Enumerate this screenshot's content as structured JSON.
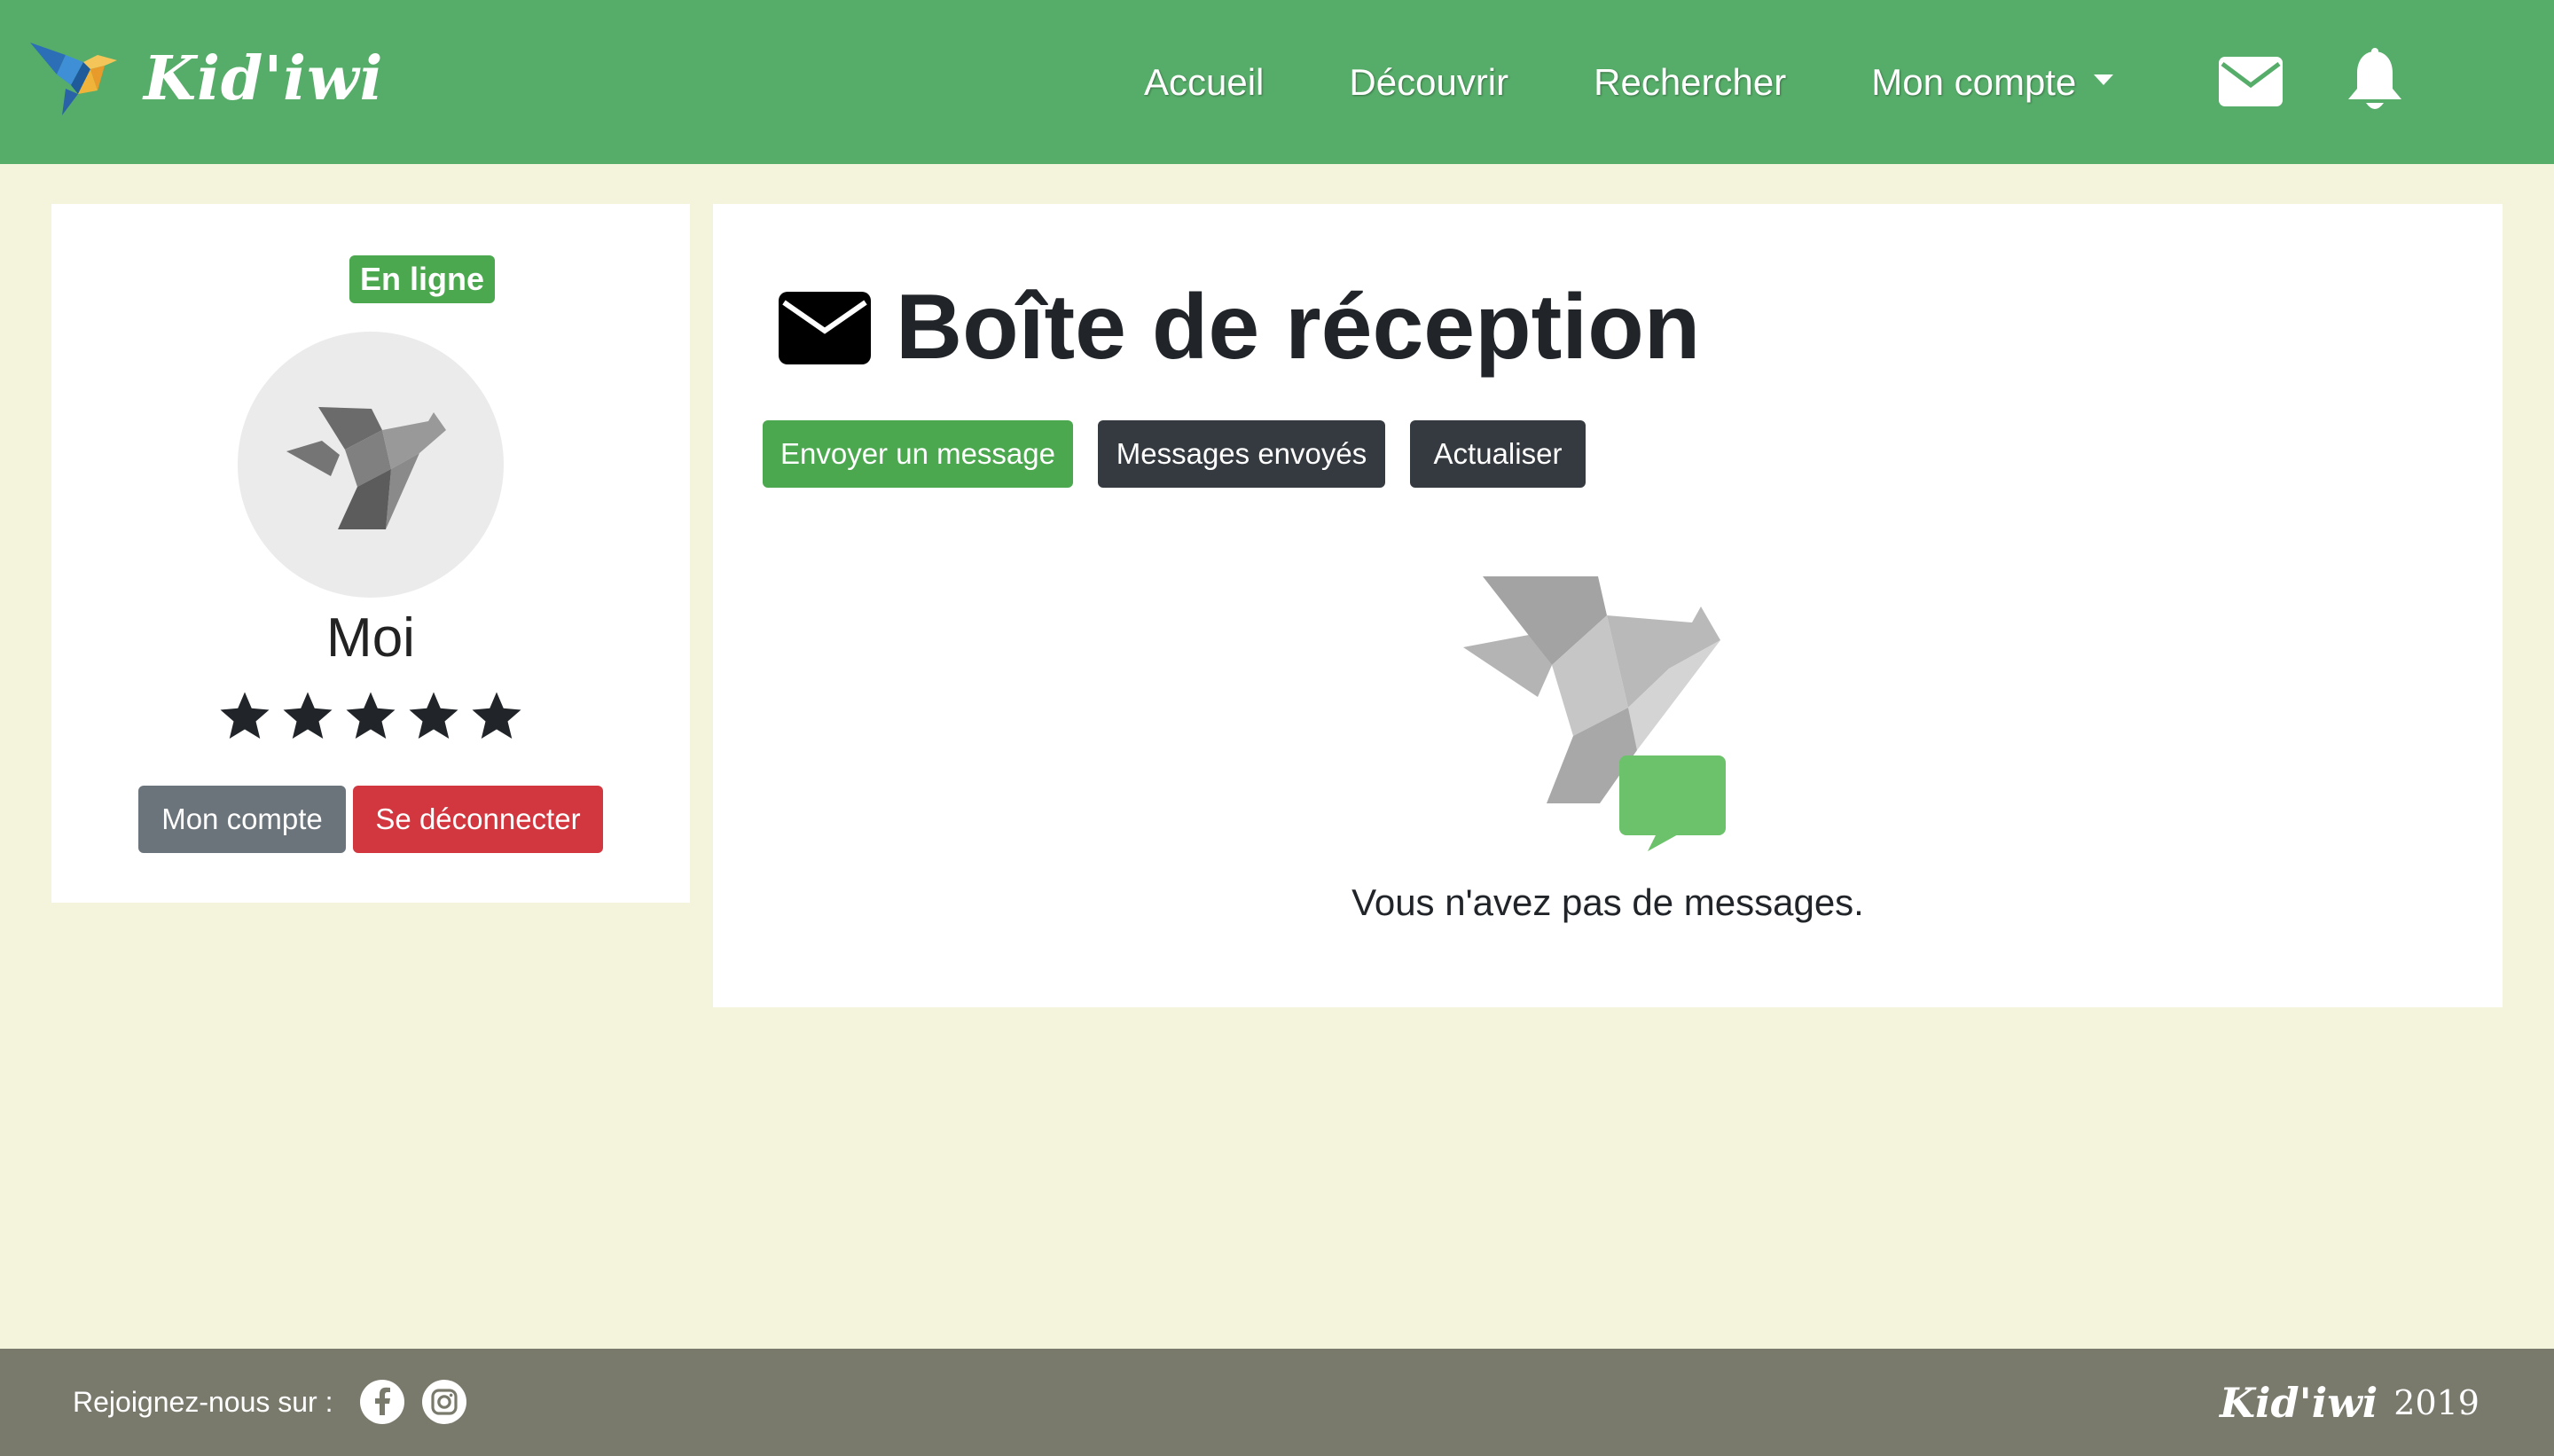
{
  "header": {
    "brand": "Kid'iwi",
    "nav": [
      {
        "label": "Accueil"
      },
      {
        "label": "Découvrir"
      },
      {
        "label": "Rechercher"
      },
      {
        "label": "Mon compte",
        "dropdown": true
      }
    ],
    "icons": [
      "envelope-icon",
      "bell-icon"
    ]
  },
  "profile": {
    "status_badge": "En ligne",
    "name": "Moi",
    "rating": 5,
    "rating_max": 5,
    "account_button": "Mon compte",
    "logout_button": "Se déconnecter"
  },
  "inbox": {
    "title": "Boîte de réception",
    "send_button": "Envoyer un message",
    "sent_button": "Messages envoyés",
    "refresh_button": "Actualiser",
    "empty_message": "Vous n'avez pas de messages."
  },
  "footer": {
    "join_label": "Rejoignez-nous sur :",
    "social": [
      "facebook-icon",
      "instagram-icon"
    ],
    "brand": "Kid'iwi",
    "year": "2019"
  },
  "colors": {
    "navbar": "#56ad69",
    "page_background": "#f4f4dc",
    "success": "#4ba84f",
    "danger": "#d2373f",
    "secondary": "#6b737b",
    "dark": "#353a40",
    "footer": "#7a7a6c",
    "chat_bubble": "#6cc26a"
  }
}
